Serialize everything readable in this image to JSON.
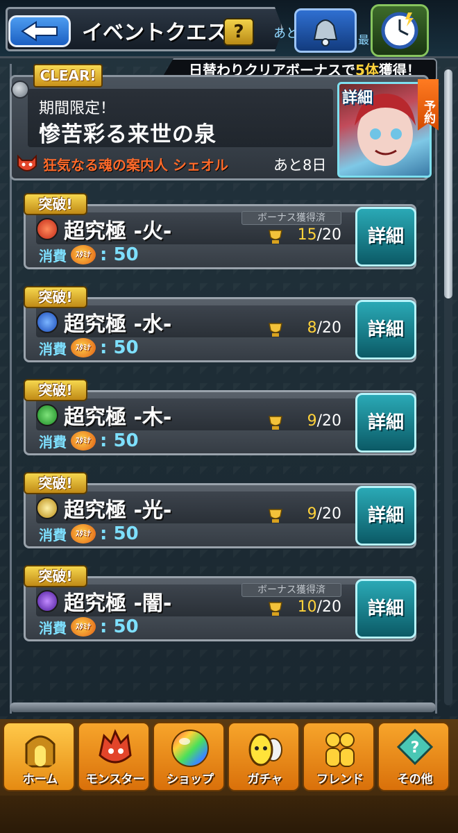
{
  "header": {
    "title": "イベントクエスト",
    "help_label": "?",
    "remain_prefix": "あと",
    "mini_label": "最"
  },
  "event": {
    "clear_badge": "CLEAR!",
    "daily_bonus_prefix": "日替わりクリアボーナスで",
    "daily_bonus_highlight": "5体",
    "daily_bonus_suffix": "獲得！",
    "limited_label": "期間限定！",
    "title": "惨苦彩る来世の泉",
    "boss_name": "狂気なる魂の案内人 シェオル",
    "remain": "あと8日",
    "detail_label": "詳細",
    "reserve_label": "予約"
  },
  "quests": [
    {
      "badge": "突破!",
      "name": "超究極 -火-",
      "element": "fire",
      "bonus_got": "ボーナス獲得済",
      "progress_got": "15",
      "progress_total": "/20",
      "cost_label": "消費",
      "stamina_label": "ｽﾀﾐﾅ",
      "cost_value": ": 50",
      "detail_label": "詳細"
    },
    {
      "badge": "突破!",
      "name": "超究極 -水-",
      "element": "water",
      "bonus_got": "",
      "progress_got": "8",
      "progress_total": "/20",
      "cost_label": "消費",
      "stamina_label": "ｽﾀﾐﾅ",
      "cost_value": ": 50",
      "detail_label": "詳細"
    },
    {
      "badge": "突破!",
      "name": "超究極 -木-",
      "element": "wood",
      "bonus_got": "",
      "progress_got": "9",
      "progress_total": "/20",
      "cost_label": "消費",
      "stamina_label": "ｽﾀﾐﾅ",
      "cost_value": ": 50",
      "detail_label": "詳細"
    },
    {
      "badge": "突破!",
      "name": "超究極 -光-",
      "element": "light",
      "bonus_got": "",
      "progress_got": "9",
      "progress_total": "/20",
      "cost_label": "消費",
      "stamina_label": "ｽﾀﾐﾅ",
      "cost_value": ": 50",
      "detail_label": "詳細"
    },
    {
      "badge": "突破!",
      "name": "超究極 -闇-",
      "element": "dark",
      "bonus_got": "ボーナス獲得済",
      "progress_got": "10",
      "progress_total": "/20",
      "cost_label": "消費",
      "stamina_label": "ｽﾀﾐﾅ",
      "cost_value": ": 50",
      "detail_label": "詳細"
    }
  ],
  "nav": [
    {
      "label": "ホーム",
      "icon": "home-icon",
      "active": true
    },
    {
      "label": "モンスター",
      "icon": "monster-icon",
      "active": false
    },
    {
      "label": "ショップ",
      "icon": "shop-orb-icon",
      "active": false
    },
    {
      "label": "ガチャ",
      "icon": "gacha-egg-icon",
      "active": false
    },
    {
      "label": "フレンド",
      "icon": "friend-icon",
      "active": false
    },
    {
      "label": "その他",
      "icon": "other-icon",
      "active": false
    }
  ],
  "colors": {
    "accent_gold": "#ffd23a",
    "cyan": "#7ee0ff",
    "boss_red": "#ff6a2a",
    "fire": "#e0402a",
    "water": "#2f6fe0",
    "wood": "#2fae3a",
    "light": "#e8c24a",
    "dark": "#7a3ad8"
  }
}
